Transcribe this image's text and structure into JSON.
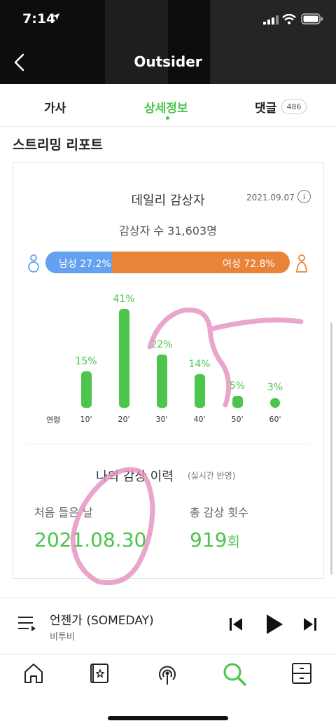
{
  "status_bar": {
    "time": "7:14"
  },
  "header": {
    "title": "Outsider"
  },
  "tabs": [
    {
      "label": "가사"
    },
    {
      "label": "상세정보",
      "active": true
    },
    {
      "label": "댓글",
      "badge": "486"
    }
  ],
  "section": {
    "title": "스트리밍 리포트"
  },
  "daily": {
    "title": "데일리 감상자",
    "date": "2021.09.07",
    "listeners": "감상자 수 31,603명",
    "male_label": "남성 27.2%",
    "female_label": "여성 72.8%",
    "male_share": 27.2,
    "female_share": 72.8,
    "age_caption": "연령"
  },
  "chart_data": {
    "type": "bar",
    "categories": [
      "10'",
      "20'",
      "30'",
      "40'",
      "50'",
      "60'"
    ],
    "values": [
      15,
      41,
      22,
      14,
      5,
      3
    ],
    "labels": [
      "15%",
      "41%",
      "22%",
      "14%",
      "5%",
      "3%"
    ],
    "color": "#4cc54c"
  },
  "history": {
    "title": "나의 감상 이력",
    "note": "(실시간 반영)",
    "first_label": "처음 들은 날",
    "first_value": "2021.08.30",
    "count_label": "총 감상 횟수",
    "count_value": "919",
    "count_unit": "회"
  },
  "player": {
    "song": "언젠가 (SOMEDAY)",
    "artist": "비투비"
  },
  "icons": [
    "back-icon",
    "info-icon",
    "male-icon",
    "female-icon",
    "playlist-icon",
    "prev-icon",
    "play-icon",
    "next-icon",
    "home-icon",
    "library-icon",
    "podcast-icon",
    "search-icon",
    "storage-icon"
  ],
  "colors": {
    "accent": "#4cc54c",
    "male": "#64a1f1",
    "female": "#e8833a",
    "scribble": "#e58fbe"
  }
}
